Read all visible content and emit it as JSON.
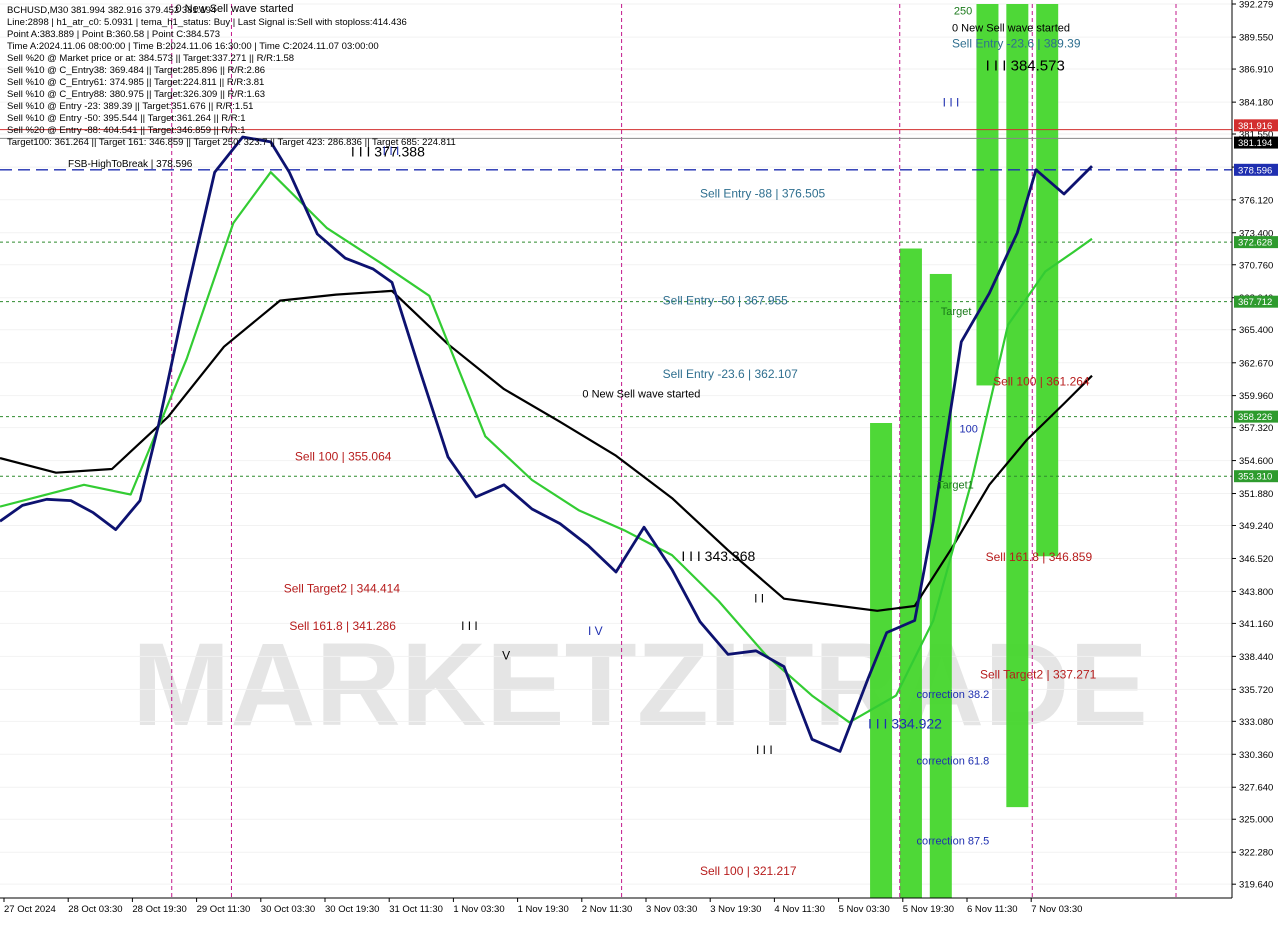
{
  "info_lines": [
    "BCHUSD,M30  381.994 382.916 379.452 381.194",
    "Line:2898  |  h1_atr_c0: 5.0931  |  tema_h1_status: Buy  |  Last Signal is:Sell with stoploss:414.436",
    "Point A:383.889  |  Point B:360.58  |  Point C:384.573",
    "Time A:2024.11.06 08:00:00  |  Time B:2024.11.06 16:30:00  |  Time C:2024.11.07 03:00:00",
    "Sell %20 @ Market price or at: 384.573  ||  Target:337.271  ||  R/R:1.58",
    "Sell %10 @ C_Entry38: 369.484  ||  Target:285.896  ||  R/R:2.86",
    "Sell %10 @ C_Entry61: 374.985  ||  Target:224.811  ||  R/R:3.81",
    "Sell %10 @ C_Entry88: 380.975  ||  Target:326.309  ||  R/R:1.63",
    "Sell %10 @ Entry -23: 389.39  ||  Target:351.676  ||  R/R:1.51",
    "Sell %10 @ Entry -50: 395.544  ||  Target:361.264  ||  R/R:1",
    "Sell %20 @ Entry -88: 404.541  ||  Target:346.859  ||  R/R:1",
    "Target100: 361.264  ||  Target 161: 346.859  ||  Target 250: 323.7  ||  Target 423: 286.836  ||  Target 685: 224.811"
  ],
  "watermark": "MARKETZITRADE",
  "chart_data": {
    "type": "line",
    "symbol": "BCHUSD",
    "timeframe": "M30",
    "ylim": [
      318.5,
      392.279
    ],
    "y_ticks": [
      "392.279",
      "389.550",
      "386.910",
      "384.180",
      "381.550",
      "378.820",
      "376.120",
      "373.400",
      "370.760",
      "368.040",
      "365.400",
      "362.670",
      "359.960",
      "357.320",
      "354.600",
      "351.880",
      "349.240",
      "346.520",
      "343.800",
      "341.160",
      "338.440",
      "335.720",
      "333.080",
      "330.360",
      "327.640",
      "325.000",
      "322.280",
      "319.640"
    ],
    "x_ticks": [
      "27 Oct 2024",
      "28 Oct 03:30",
      "28 Oct 19:30",
      "29 Oct 11:30",
      "30 Oct 03:30",
      "30 Oct 19:30",
      "31 Oct 11:30",
      "1 Nov 03:30",
      "1 Nov 19:30",
      "2 Nov 11:30",
      "3 Nov 03:30",
      "3 Nov 19:30",
      "4 Nov 11:30",
      "5 Nov 03:30",
      "5 Nov 19:30",
      "6 Nov 11:30",
      "7 Nov 03:30"
    ],
    "price_line": {
      "value": 381.194,
      "label": "381.194",
      "color": "#000000"
    },
    "resistance_line": {
      "value": 381.916,
      "label": "381.916",
      "color": "#d32f2f"
    },
    "fsb_line": {
      "value": 378.596,
      "label": "378.596",
      "text": "FSB-HighToBreak | 378.596",
      "color": "#1f2fb0"
    },
    "green_levels": [
      {
        "value": 372.628,
        "label": "372.628"
      },
      {
        "value": 367.712,
        "label": "367.712"
      },
      {
        "value": 358.226,
        "label": "358.226"
      },
      {
        "value": 353.31,
        "label": "353.310"
      }
    ],
    "annotations": [
      {
        "text": "Sell Entry -88 | 376.505",
        "x": 3.75,
        "y": 376.3,
        "color": "#2f6f8f",
        "size": 12
      },
      {
        "text": "Sell Entry -50 | 367.955",
        "x": 3.55,
        "y": 367.5,
        "color": "#2f6f8f",
        "size": 12
      },
      {
        "text": "Sell Entry -23.6 | 362.107",
        "x": 3.55,
        "y": 361.4,
        "color": "#2f6f8f",
        "size": 12
      },
      {
        "text": "0 New Sell wave started",
        "x": 3.12,
        "y": 359.8,
        "color": "#000000",
        "size": 11
      },
      {
        "text": "Sell 100 | 355.064",
        "x": 1.58,
        "y": 354.6,
        "color": "#b71c1c",
        "size": 12
      },
      {
        "text": "Sell Target2 | 344.414",
        "x": 1.52,
        "y": 343.7,
        "color": "#b71c1c",
        "size": 12
      },
      {
        "text": "Sell 161.8 | 341.286",
        "x": 1.55,
        "y": 340.6,
        "color": "#b71c1c",
        "size": 12
      },
      {
        "text": "I I I 343.368",
        "x": 3.65,
        "y": 346.3,
        "color": "#000000",
        "size": 14
      },
      {
        "text": "I I I 377.388",
        "x": 1.88,
        "y": 379.7,
        "color": "#000000",
        "size": 14
      },
      {
        "text": "I I I 334.922",
        "x": 4.65,
        "y": 332.5,
        "color": "#1f2fb0",
        "size": 14
      },
      {
        "text": "Sell 100 | 321.217",
        "x": 3.75,
        "y": 320.4,
        "color": "#b71c1c",
        "size": 12
      },
      {
        "text": "0 New Sell wave started",
        "x": 5.1,
        "y": 390.0,
        "color": "#000000",
        "size": 11
      },
      {
        "text": "Sell Entry -23.6 | 389.39",
        "x": 5.1,
        "y": 388.7,
        "color": "#2f6f8f",
        "size": 12
      },
      {
        "text": "I I I 384.573",
        "x": 5.28,
        "y": 386.8,
        "color": "#000000",
        "size": 15
      },
      {
        "text": "Sell 100 | 361.264",
        "x": 5.32,
        "y": 360.8,
        "color": "#b71c1c",
        "size": 12
      },
      {
        "text": "Sell 161.8 | 346.859",
        "x": 5.28,
        "y": 346.3,
        "color": "#b71c1c",
        "size": 12
      },
      {
        "text": "Sell Target2 | 337.271",
        "x": 5.25,
        "y": 336.6,
        "color": "#b71c1c",
        "size": 12
      },
      {
        "text": "correction 38.2",
        "x": 4.91,
        "y": 335.0,
        "color": "#1f2fb0",
        "size": 11
      },
      {
        "text": "correction 61.8",
        "x": 4.91,
        "y": 329.5,
        "color": "#1f2fb0",
        "size": 11
      },
      {
        "text": "correction 87.5",
        "x": 4.91,
        "y": 322.9,
        "color": "#1f2fb0",
        "size": 11
      },
      {
        "text": "Target1",
        "x": 5.02,
        "y": 352.3,
        "color": "#1b7a1b",
        "size": 11
      },
      {
        "text": "Target",
        "x": 5.04,
        "y": 366.6,
        "color": "#1b7a1b",
        "size": 11
      },
      {
        "text": "100",
        "x": 5.14,
        "y": 356.9,
        "color": "#1f2fb0",
        "size": 11
      },
      {
        "text": "I I",
        "x": 4.04,
        "y": 342.9,
        "color": "#000000",
        "size": 12
      },
      {
        "text": "I I I",
        "x": 2.47,
        "y": 340.6,
        "color": "#000000",
        "size": 12
      },
      {
        "text": "I I I",
        "x": 4.05,
        "y": 330.4,
        "color": "#000000",
        "size": 12
      },
      {
        "text": "I V",
        "x": 3.15,
        "y": 340.2,
        "color": "#1f2fb0",
        "size": 12
      },
      {
        "text": "V",
        "x": 2.69,
        "y": 338.2,
        "color": "#000000",
        "size": 12
      },
      {
        "text": "I I I",
        "x": 5.05,
        "y": 383.8,
        "color": "#1f2fb0",
        "size": 12
      },
      {
        "text": "I I I",
        "x": 2.05,
        "y": 379.8,
        "color": "#1f2fb0",
        "size": 12
      },
      {
        "text": "0 New Sell wave started",
        "x": 0.94,
        "y": 391.6,
        "color": "#000000",
        "size": 11
      },
      {
        "text": "250",
        "x": 5.11,
        "y": 391.4,
        "color": "#1b7a1b",
        "size": 11
      }
    ],
    "vertical_day_lines": [
      0.92,
      1.24,
      3.33,
      4.82,
      5.53,
      6.3
    ],
    "green_bars": [
      {
        "x": 4.72,
        "y0": 318.5,
        "y1": 357.7
      },
      {
        "x": 4.88,
        "y0": 318.5,
        "y1": 372.1
      },
      {
        "x": 5.04,
        "y0": 318.5,
        "y1": 370.0
      },
      {
        "x": 5.29,
        "y0": 360.8,
        "y1": 392.279
      },
      {
        "x": 5.45,
        "y0": 326.0,
        "y1": 392.279
      },
      {
        "x": 5.61,
        "y0": 346.7,
        "y1": 392.279
      }
    ],
    "series": [
      {
        "name": "",
        "color": "#000000",
        "width": 2.2,
        "x": [
          0,
          0.3,
          0.6,
          0.9,
          1.2,
          1.5,
          1.8,
          2.1,
          2.4,
          2.7,
          3.0,
          3.3,
          3.6,
          3.9,
          4.2,
          4.5,
          4.7,
          4.9,
          5.1,
          5.3,
          5.5,
          5.7,
          5.85
        ],
        "y": [
          354.8,
          353.6,
          353.9,
          358.2,
          364.0,
          367.8,
          368.3,
          368.6,
          364.2,
          360.5,
          357.8,
          355.0,
          351.5,
          347.2,
          343.2,
          342.6,
          342.2,
          342.6,
          347.4,
          352.6,
          356.3,
          359.3,
          361.6
        ]
      },
      {
        "name": "",
        "color": "#33cc33",
        "width": 2.2,
        "x": [
          0,
          0.2,
          0.45,
          0.7,
          1.0,
          1.25,
          1.45,
          1.75,
          2.05,
          2.3,
          2.6,
          2.85,
          3.1,
          3.35,
          3.6,
          3.85,
          4.1,
          4.35,
          4.55,
          4.8,
          5.0,
          5.2,
          5.4,
          5.6,
          5.75,
          5.85
        ],
        "y": [
          350.8,
          351.6,
          352.6,
          351.8,
          363.0,
          374.2,
          378.4,
          373.8,
          370.8,
          368.2,
          356.6,
          353.0,
          350.5,
          348.8,
          346.8,
          343.0,
          338.6,
          335.2,
          333.0,
          335.2,
          341.4,
          352.6,
          365.8,
          370.2,
          371.8,
          372.9
        ]
      },
      {
        "name": "",
        "color": "#0d1270",
        "width": 2.8,
        "x": [
          0,
          0.12,
          0.25,
          0.38,
          0.5,
          0.62,
          0.75,
          0.85,
          1.0,
          1.15,
          1.3,
          1.45,
          1.55,
          1.7,
          1.85,
          2.0,
          2.1,
          2.25,
          2.4,
          2.55,
          2.7,
          2.85,
          3.0,
          3.15,
          3.3,
          3.45,
          3.6,
          3.75,
          3.9,
          4.05,
          4.2,
          4.35,
          4.5,
          4.65,
          4.75,
          4.9,
          5.0,
          5.15,
          5.3,
          5.45,
          5.55,
          5.7,
          5.85
        ],
        "y": [
          349.6,
          350.9,
          351.4,
          351.3,
          350.3,
          348.9,
          351.3,
          357.6,
          368.4,
          378.4,
          381.3,
          380.9,
          378.4,
          373.3,
          371.3,
          370.4,
          369.3,
          362.0,
          354.9,
          351.6,
          352.6,
          350.6,
          349.4,
          347.6,
          345.4,
          349.1,
          345.6,
          341.3,
          338.6,
          338.9,
          337.6,
          331.6,
          330.6,
          336.6,
          340.4,
          341.4,
          349.6,
          364.4,
          368.4,
          373.4,
          378.6,
          376.6,
          378.9
        ]
      }
    ]
  }
}
